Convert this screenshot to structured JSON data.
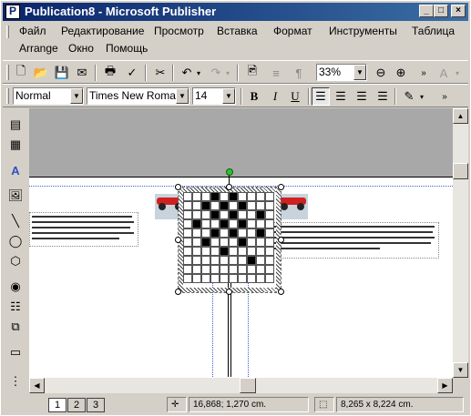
{
  "window": {
    "title": "Publication8 - Microsoft Publisher"
  },
  "menu": {
    "items_row1": [
      "Файл",
      "Редактирование",
      "Просмотр",
      "Вставка",
      "Формат",
      "Инструменты",
      "Таблица"
    ],
    "items_row2": [
      "Arrange",
      "Окно",
      "Помощь"
    ]
  },
  "toolbar": {
    "zoom_value": "33%",
    "style_value": "Normal",
    "font_value": "Times New Roman",
    "size_value": "14"
  },
  "status": {
    "pages": [
      "1",
      "2",
      "3"
    ],
    "position": "16,868; 1,270 cm.",
    "size": "8,265 x  8,224 cm."
  }
}
